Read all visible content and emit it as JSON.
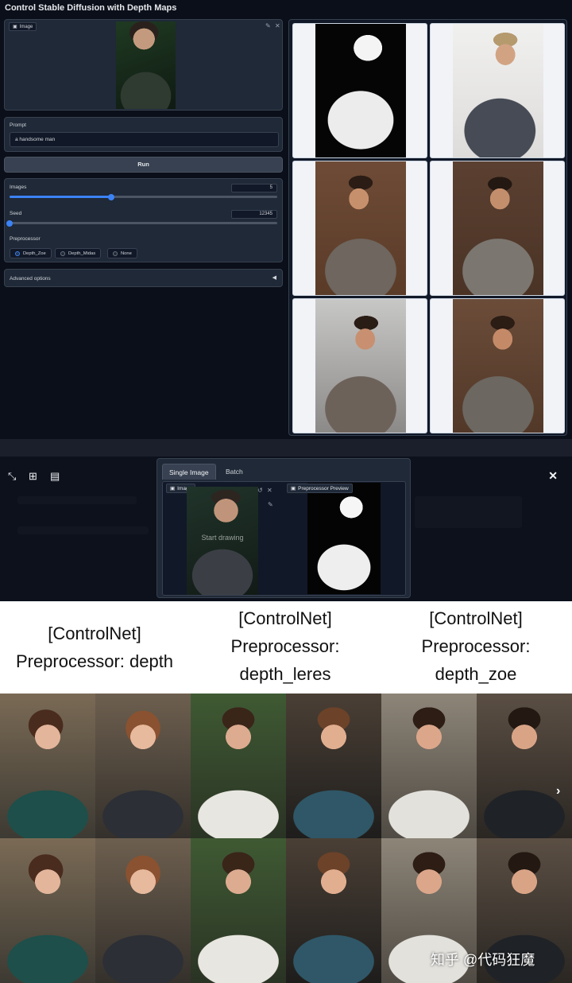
{
  "top": {
    "title": "Control Stable Diffusion with Depth Maps",
    "image_label": "Image",
    "prompt_label": "Prompt",
    "prompt_value": "a handsome man",
    "run_label": "Run",
    "images_label": "Images",
    "images_value": "5",
    "images_fraction": 0.38,
    "seed_label": "Seed",
    "seed_value": "12345",
    "seed_fraction": 0.0,
    "preprocessor_label": "Preprocessor",
    "preprocessor_options": [
      "Depth_Zoe",
      "Depth_Midas",
      "None"
    ],
    "preprocessor_selected": "Depth_Zoe",
    "advanced_label": "Advanced options",
    "advanced_caret": "◀"
  },
  "controlnet": {
    "tabs": [
      "Single Image",
      "Batch"
    ],
    "active_tab": "Single Image",
    "image_label": "Image",
    "overlay_text": "Start drawing",
    "preview_label": "Preprocessor Preview",
    "close_glyph": "✕"
  },
  "labels": [
    "[ControlNet]\nPreprocessor: depth",
    "[ControlNet]\nPreprocessor:\ndepth_leres",
    "[ControlNet]\nPreprocessor:\ndepth_zoe"
  ],
  "watermark": "知乎 @代码狂魔",
  "colors": {
    "app_bg": "#0b0f19",
    "panel_bg": "#1f2937",
    "accent": "#3b82f6",
    "label_bg": "#ffffff"
  }
}
